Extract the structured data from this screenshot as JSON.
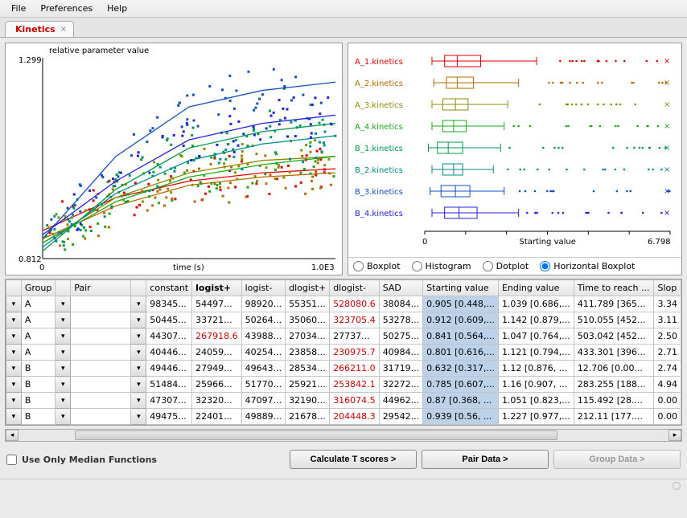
{
  "menu": {
    "file": "File",
    "preferences": "Preferences",
    "help": "Help"
  },
  "tab": {
    "label": "Kinetics"
  },
  "scatter": {
    "ylabel": "relative parameter value",
    "xlabel": "time (s)",
    "ymin": "0.812",
    "ymax": "1.299",
    "xmin": "0",
    "xmax": "1.0E3"
  },
  "boxplot": {
    "xlabel": "Starting value",
    "xmin": "0",
    "xmax": "6.798",
    "series": [
      {
        "name": "A_1.kinetics",
        "color": "#e00000"
      },
      {
        "name": "A_2.kinetics",
        "color": "#b86a00"
      },
      {
        "name": "A_3.kinetics",
        "color": "#8c8c00"
      },
      {
        "name": "A_4.kinetics",
        "color": "#18a818"
      },
      {
        "name": "B_1.kinetics",
        "color": "#009a4a"
      },
      {
        "name": "B_2.kinetics",
        "color": "#008a88"
      },
      {
        "name": "B_3.kinetics",
        "color": "#1050c0"
      },
      {
        "name": "B_4.kinetics",
        "color": "#2020e0"
      }
    ]
  },
  "radios": {
    "boxplot": "Boxplot",
    "histogram": "Histogram",
    "dotplot": "Dotplot",
    "hboxplot": "Horizontal Boxplot"
  },
  "table": {
    "headers": [
      "",
      "Group",
      "",
      "Pair",
      "",
      "constant",
      "logist+",
      "logist-",
      "dlogist+",
      "dlogist-",
      "SAD",
      "Starting value",
      "Ending value",
      "Time to reach ...",
      "Slop"
    ],
    "rows": [
      {
        "g": "A",
        "c0": "98345...",
        "c1": "54497...",
        "c2": "98920...",
        "c3": "55351...",
        "c4": "528080.6",
        "c4red": true,
        "c5": "38084...",
        "sv": "0.905 [0.448,...",
        "ev": "1.039 [0.686,...",
        "tr": "411.789 [365...",
        "sl": "3.34"
      },
      {
        "g": "A",
        "c0": "50445...",
        "c1": "33721...",
        "c2": "50264...",
        "c3": "35060...",
        "c4": "323705.4",
        "c4red": true,
        "c5": "53278...",
        "sv": "0.912 [0.609,...",
        "ev": "1.142 [0.879,...",
        "tr": "510.055 [452...",
        "sl": "3.11"
      },
      {
        "g": "A",
        "c0": "44307...",
        "c1": "267918.6",
        "c1red": true,
        "c2": "43988...",
        "c3": "27034...",
        "c4": "27737...",
        "c5": "50275...",
        "sv": "0.841 [0.564,...",
        "ev": "1.047 [0.764,...",
        "tr": "503.042 [452...",
        "sl": "2.50"
      },
      {
        "g": "A",
        "c0": "40446...",
        "c1": "24059...",
        "c2": "40254...",
        "c3": "23858...",
        "c4": "230975.7",
        "c4red": true,
        "c5": "40984...",
        "sv": "0.801 [0.616,...",
        "ev": "1.121 [0.794,...",
        "tr": "433.301 [396...",
        "sl": "2.71"
      },
      {
        "g": "B",
        "c0": "49446...",
        "c1": "27949...",
        "c2": "49643...",
        "c3": "28534...",
        "c4": "266211.0",
        "c4red": true,
        "c5": "31719...",
        "sv": "0.632 [0.317,...",
        "ev": "1.12 [0.876, ...",
        "tr": "12.706 [0.00...",
        "sl": "2.74"
      },
      {
        "g": "B",
        "c0": "51484...",
        "c1": "25966...",
        "c2": "51770...",
        "c3": "25921...",
        "c4": "253842.1",
        "c4red": true,
        "c5": "32272...",
        "sv": "0.785 [0.607,...",
        "ev": "1.16 [0.907, ...",
        "tr": "283.255 [188...",
        "sl": "4.94"
      },
      {
        "g": "B",
        "c0": "47307...",
        "c1": "32320...",
        "c2": "47097...",
        "c3": "32190...",
        "c4": "316074.5",
        "c4red": true,
        "c5": "44962...",
        "sv": "0.87 [0.368, ...",
        "ev": "1.051 [0.823,...",
        "tr": "115.492 [28....",
        "sl": "0.00"
      },
      {
        "g": "B",
        "c0": "49475...",
        "c1": "22401...",
        "c2": "49889...",
        "c3": "21678...",
        "c4": "204448.3",
        "c4red": true,
        "c5": "29542...",
        "sv": "0.939 [0.56, ...",
        "ev": "1.227 [0.977,...",
        "tr": "212.11 [177....",
        "sl": "0.00"
      }
    ]
  },
  "buttons": {
    "median_chk": "Use Only Median Functions",
    "calc_t": "Calculate T scores >",
    "pair": "Pair Data >",
    "group": "Group Data >"
  },
  "chart_data": [
    {
      "type": "scatter",
      "title": "",
      "xlabel": "time (s)",
      "ylabel": "relative parameter value",
      "xlim": [
        0,
        1000
      ],
      "ylim": [
        0.812,
        1.299
      ],
      "note": "Eight overlaid scatter series with fitted logistic curves; approximate medians read from fitted lines at x=0,250,500,750,1000.",
      "series": [
        {
          "name": "A_1.kinetics",
          "color": "#e00000",
          "x": [
            0,
            250,
            500,
            750,
            1000
          ],
          "y": [
            0.88,
            0.96,
            1.0,
            1.02,
            1.03
          ]
        },
        {
          "name": "A_2.kinetics",
          "color": "#b86a00",
          "x": [
            0,
            250,
            500,
            750,
            1000
          ],
          "y": [
            0.86,
            0.94,
            0.99,
            1.01,
            1.02
          ]
        },
        {
          "name": "A_3.kinetics",
          "color": "#8c8c00",
          "x": [
            0,
            250,
            500,
            750,
            1000
          ],
          "y": [
            0.85,
            0.96,
            1.02,
            1.05,
            1.06
          ]
        },
        {
          "name": "A_4.kinetics",
          "color": "#18a818",
          "x": [
            0,
            250,
            500,
            750,
            1000
          ],
          "y": [
            0.85,
            0.95,
            1.01,
            1.04,
            1.06
          ]
        },
        {
          "name": "B_1.kinetics",
          "color": "#009a4a",
          "x": [
            0,
            250,
            500,
            750,
            1000
          ],
          "y": [
            0.83,
            0.98,
            1.08,
            1.12,
            1.14
          ]
        },
        {
          "name": "B_2.kinetics",
          "color": "#008a88",
          "x": [
            0,
            250,
            500,
            750,
            1000
          ],
          "y": [
            0.84,
            0.97,
            1.05,
            1.09,
            1.11
          ]
        },
        {
          "name": "B_3.kinetics",
          "color": "#1050c0",
          "x": [
            0,
            250,
            500,
            750,
            1000
          ],
          "y": [
            0.86,
            1.06,
            1.18,
            1.22,
            1.24
          ]
        },
        {
          "name": "B_4.kinetics",
          "color": "#2020e0",
          "x": [
            0,
            250,
            500,
            750,
            1000
          ],
          "y": [
            0.87,
            1.0,
            1.1,
            1.14,
            1.16
          ]
        }
      ]
    },
    {
      "type": "boxplot-horizontal",
      "title": "",
      "xlabel": "Starting value",
      "xlim": [
        0,
        6.798
      ],
      "categories": [
        "A_1.kinetics",
        "A_2.kinetics",
        "A_3.kinetics",
        "A_4.kinetics",
        "B_1.kinetics",
        "B_2.kinetics",
        "B_3.kinetics",
        "B_4.kinetics"
      ],
      "boxes": [
        {
          "min": 0.2,
          "q1": 0.55,
          "med": 0.9,
          "q3": 1.55,
          "max": 3.1
        },
        {
          "min": 0.25,
          "q1": 0.6,
          "med": 0.9,
          "q3": 1.35,
          "max": 2.6
        },
        {
          "min": 0.2,
          "q1": 0.5,
          "med": 0.85,
          "q3": 1.2,
          "max": 2.3
        },
        {
          "min": 0.2,
          "q1": 0.5,
          "med": 0.8,
          "q3": 1.15,
          "max": 2.2
        },
        {
          "min": 0.1,
          "q1": 0.35,
          "med": 0.65,
          "q3": 1.05,
          "max": 2.1
        },
        {
          "min": 0.2,
          "q1": 0.5,
          "med": 0.8,
          "q3": 1.05,
          "max": 1.9
        },
        {
          "min": 0.15,
          "q1": 0.45,
          "med": 0.85,
          "q3": 1.25,
          "max": 2.2
        },
        {
          "min": 0.2,
          "q1": 0.55,
          "med": 0.95,
          "q3": 1.45,
          "max": 2.6
        }
      ],
      "outliers_note": "each series has scattered outlier points between ~2.5 and 6.7"
    }
  ]
}
